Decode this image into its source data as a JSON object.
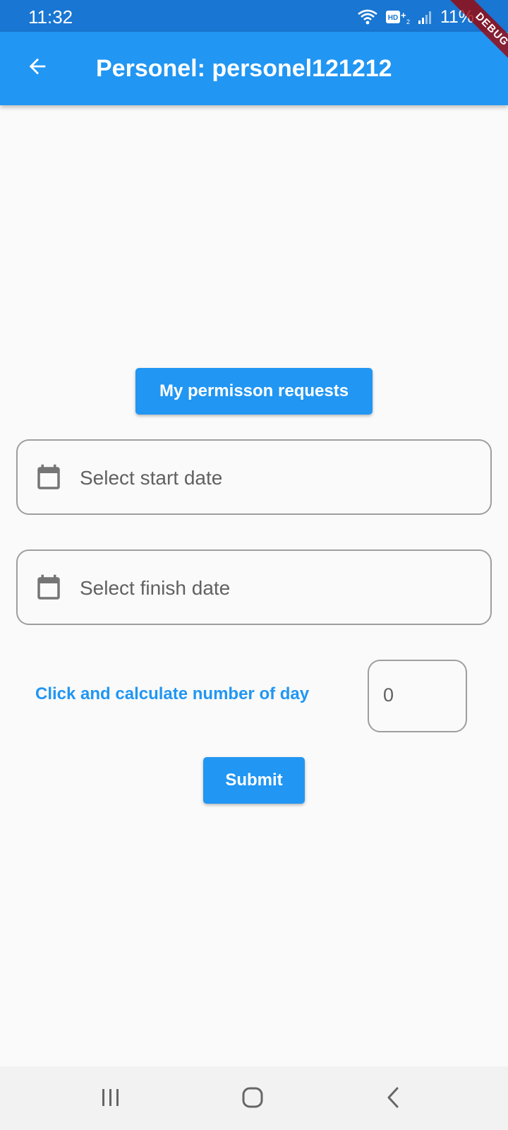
{
  "status_bar": {
    "time": "11:32",
    "battery": "11%",
    "network_label": "HD+2"
  },
  "app_bar": {
    "title": "Personel: personel121212",
    "back_icon": "arrow-back-icon"
  },
  "debug_banner": "DEBUG",
  "main": {
    "requests_button_label": "My permisson requests",
    "start_date_placeholder": "Select start date",
    "finish_date_placeholder": "Select finish date",
    "calendar_icon": "calendar-icon",
    "calculate_link": "Click and calculate number of day",
    "day_count": "0",
    "submit_label": "Submit"
  },
  "colors": {
    "primary": "#2196f3",
    "status_bar": "#1976d2",
    "background": "#fafafa",
    "border": "#9e9e9e"
  }
}
